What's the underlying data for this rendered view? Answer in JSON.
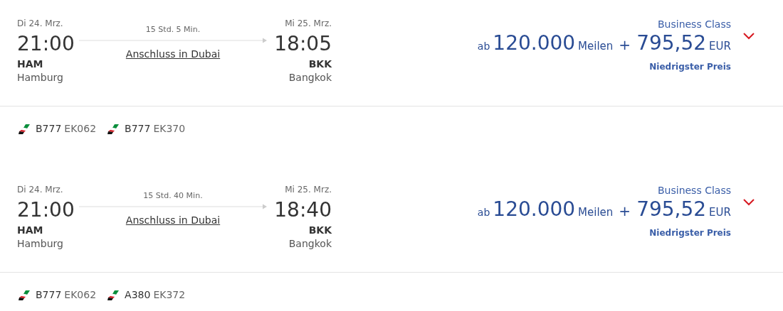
{
  "flights": [
    {
      "departure": {
        "date": "Di 24. Mrz.",
        "time": "21:00",
        "code": "HAM",
        "city": "Hamburg"
      },
      "duration": "15 Std. 5 Min.",
      "connection": "Anschluss in Dubai",
      "arrival": {
        "date": "Mi 25. Mrz.",
        "time": "18:05",
        "code": "BKK",
        "city": "Bangkok"
      },
      "cabin": "Business Class",
      "price": {
        "prefix": "ab",
        "miles": "120.000",
        "miles_unit": "Meilen",
        "plus": "+",
        "amount": "795,52",
        "currency": "EUR"
      },
      "note": "Niedrigster Preis",
      "legs": [
        {
          "aircraft": "B777",
          "flight": "EK062"
        },
        {
          "aircraft": "B777",
          "flight": "EK370"
        }
      ]
    },
    {
      "departure": {
        "date": "Di 24. Mrz.",
        "time": "21:00",
        "code": "HAM",
        "city": "Hamburg"
      },
      "duration": "15 Std. 40 Min.",
      "connection": "Anschluss in Dubai",
      "arrival": {
        "date": "Mi 25. Mrz.",
        "time": "18:40",
        "code": "BKK",
        "city": "Bangkok"
      },
      "cabin": "Business Class",
      "price": {
        "prefix": "ab",
        "miles": "120.000",
        "miles_unit": "Meilen",
        "plus": "+",
        "amount": "795,52",
        "currency": "EUR"
      },
      "note": "Niedrigster Preis",
      "legs": [
        {
          "aircraft": "B777",
          "flight": "EK062"
        },
        {
          "aircraft": "A380",
          "flight": "EK372"
        }
      ]
    }
  ]
}
